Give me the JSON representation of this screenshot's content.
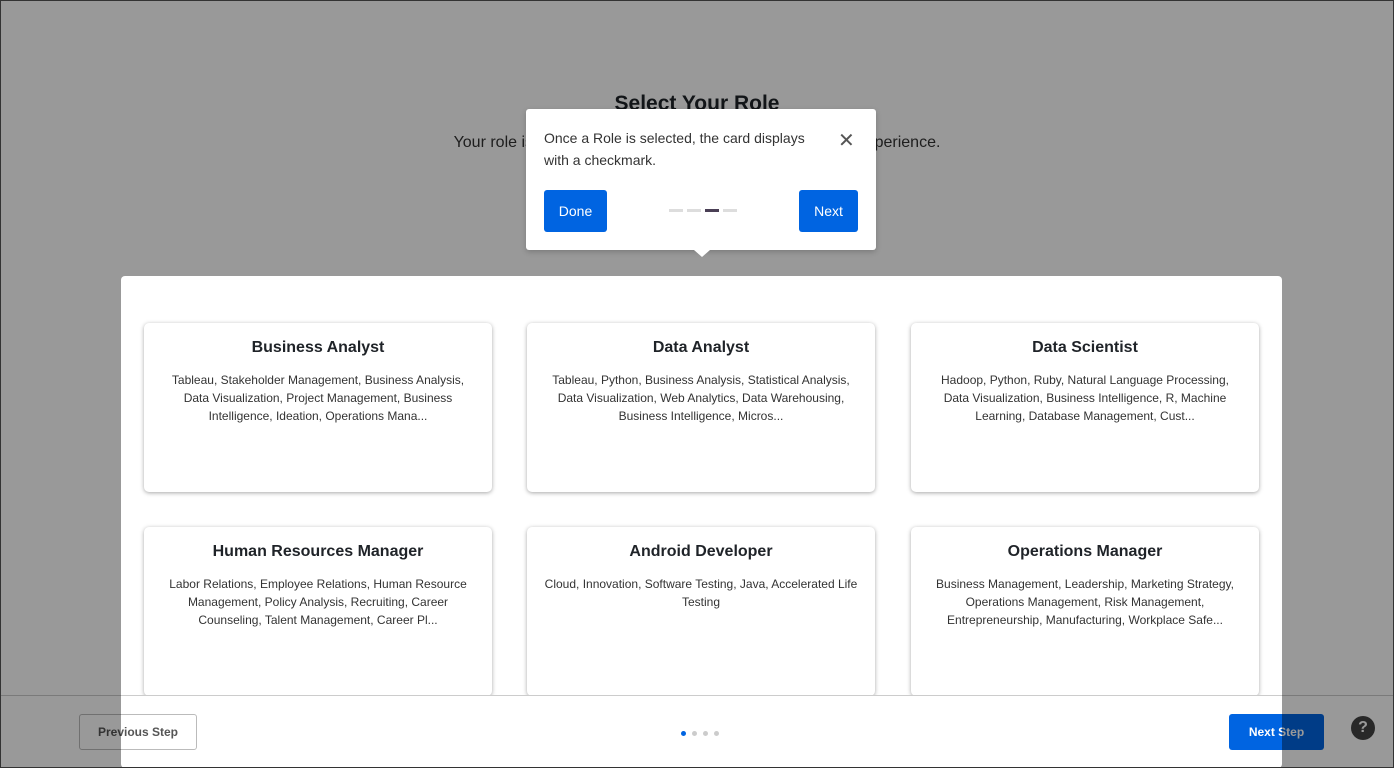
{
  "page": {
    "title": "Select Your Role",
    "subtitle": "Your role is the foundation of your personalized Degreed experience."
  },
  "roles": [
    {
      "name": "Business Analyst",
      "skills": "Tableau, Stakeholder Management, Business Analysis, Data Visualization, Project Management, Business Intelligence, Ideation, Operations Mana..."
    },
    {
      "name": "Data Analyst",
      "skills": "Tableau, Python, Business Analysis, Statistical Analysis, Data Visualization, Web Analytics, Data Warehousing, Business Intelligence, Micros..."
    },
    {
      "name": "Data Scientist",
      "skills": "Hadoop, Python, Ruby, Natural Language Processing, Data Visualization, Business Intelligence, R, Machine Learning, Database Management, Cust..."
    },
    {
      "name": "Human Resources Manager",
      "skills": "Labor Relations, Employee Relations, Human Resource Management, Policy Analysis, Recruiting, Career Counseling, Talent Management, Career Pl..."
    },
    {
      "name": "Android Developer",
      "skills": "Cloud, Innovation, Software Testing, Java, Accelerated Life Testing"
    },
    {
      "name": "Operations Manager",
      "skills": "Business Management, Leadership, Marketing Strategy, Operations Management, Risk Management, Entrepreneurship, Manufacturing, Workplace Safe..."
    }
  ],
  "footer": {
    "previous_label": "Previous Step",
    "next_label": "Next Step",
    "step_current": 1,
    "step_total": 4,
    "help_label": "?"
  },
  "tooltip": {
    "text": "Once a Role is selected, the card displays with a checkmark.",
    "done_label": "Done",
    "next_label": "Next",
    "step_current": 3,
    "step_total": 4,
    "close_icon": "close-icon"
  },
  "colors": {
    "accent": "#0064e1",
    "overlay": "rgba(0,0,0,0.4)"
  }
}
